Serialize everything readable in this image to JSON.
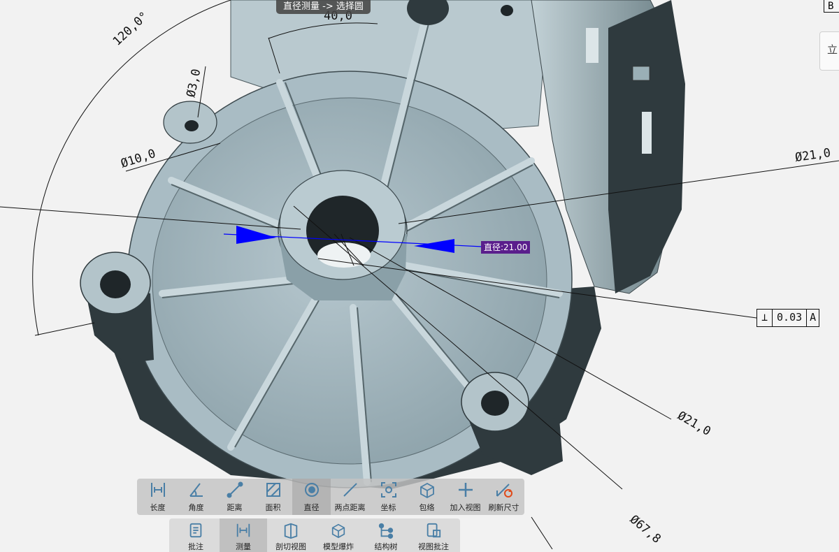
{
  "header": {
    "breadcrumb": "直径测量 -> 选择圆"
  },
  "annotations": {
    "angle": "120,0°",
    "dim_40": "40,0",
    "phi_3": "Ø3,0",
    "phi_10": "Ø10,0",
    "phi_21_a": "Ø21,0",
    "phi_21_b": "Ø21,0",
    "phi_67": "Ø67,8",
    "datum_b": "B",
    "side_tab": "立"
  },
  "gdt": {
    "symbol": "⊥",
    "tolerance": "0.03",
    "datum": "A"
  },
  "measurement": {
    "label": "直径:21.00",
    "color": "#0000ff",
    "label_bg": "#5a1e8c"
  },
  "measure_toolbar": {
    "active": "tool-diameter",
    "tools": [
      {
        "id": "length",
        "label": "长度",
        "icon": "length-icon"
      },
      {
        "id": "angle",
        "label": "角度",
        "icon": "angle-icon"
      },
      {
        "id": "distance",
        "label": "距离",
        "icon": "distance-icon"
      },
      {
        "id": "area",
        "label": "面积",
        "icon": "area-icon"
      },
      {
        "id": "diameter",
        "label": "直径",
        "icon": "diameter-icon"
      },
      {
        "id": "two-point",
        "label": "两点距离",
        "icon": "two-point-icon"
      },
      {
        "id": "coord",
        "label": "坐标",
        "icon": "coordinate-icon"
      },
      {
        "id": "bbox",
        "label": "包络",
        "icon": "bounding-box-icon"
      },
      {
        "id": "add-view",
        "label": "加入视图",
        "icon": "plus-icon"
      },
      {
        "id": "refresh",
        "label": "刷新尺寸",
        "icon": "refresh-dimension-icon"
      }
    ]
  },
  "main_toolbar": {
    "tools": [
      {
        "label": "批注",
        "icon": "annotation-icon"
      },
      {
        "label": "测量",
        "icon": "measure-icon"
      },
      {
        "label": "剖切视图",
        "icon": "section-view-icon"
      },
      {
        "label": "模型爆炸",
        "icon": "explode-model-icon"
      },
      {
        "label": "结构树",
        "icon": "structure-tree-icon"
      },
      {
        "label": "视图批注",
        "icon": "view-annotation-icon"
      }
    ]
  },
  "colors": {
    "model": "#a9bcc4",
    "model_dark": "#2f3a3e",
    "toolbar": "#c3c3c3",
    "accent": "#4a7fa6"
  }
}
